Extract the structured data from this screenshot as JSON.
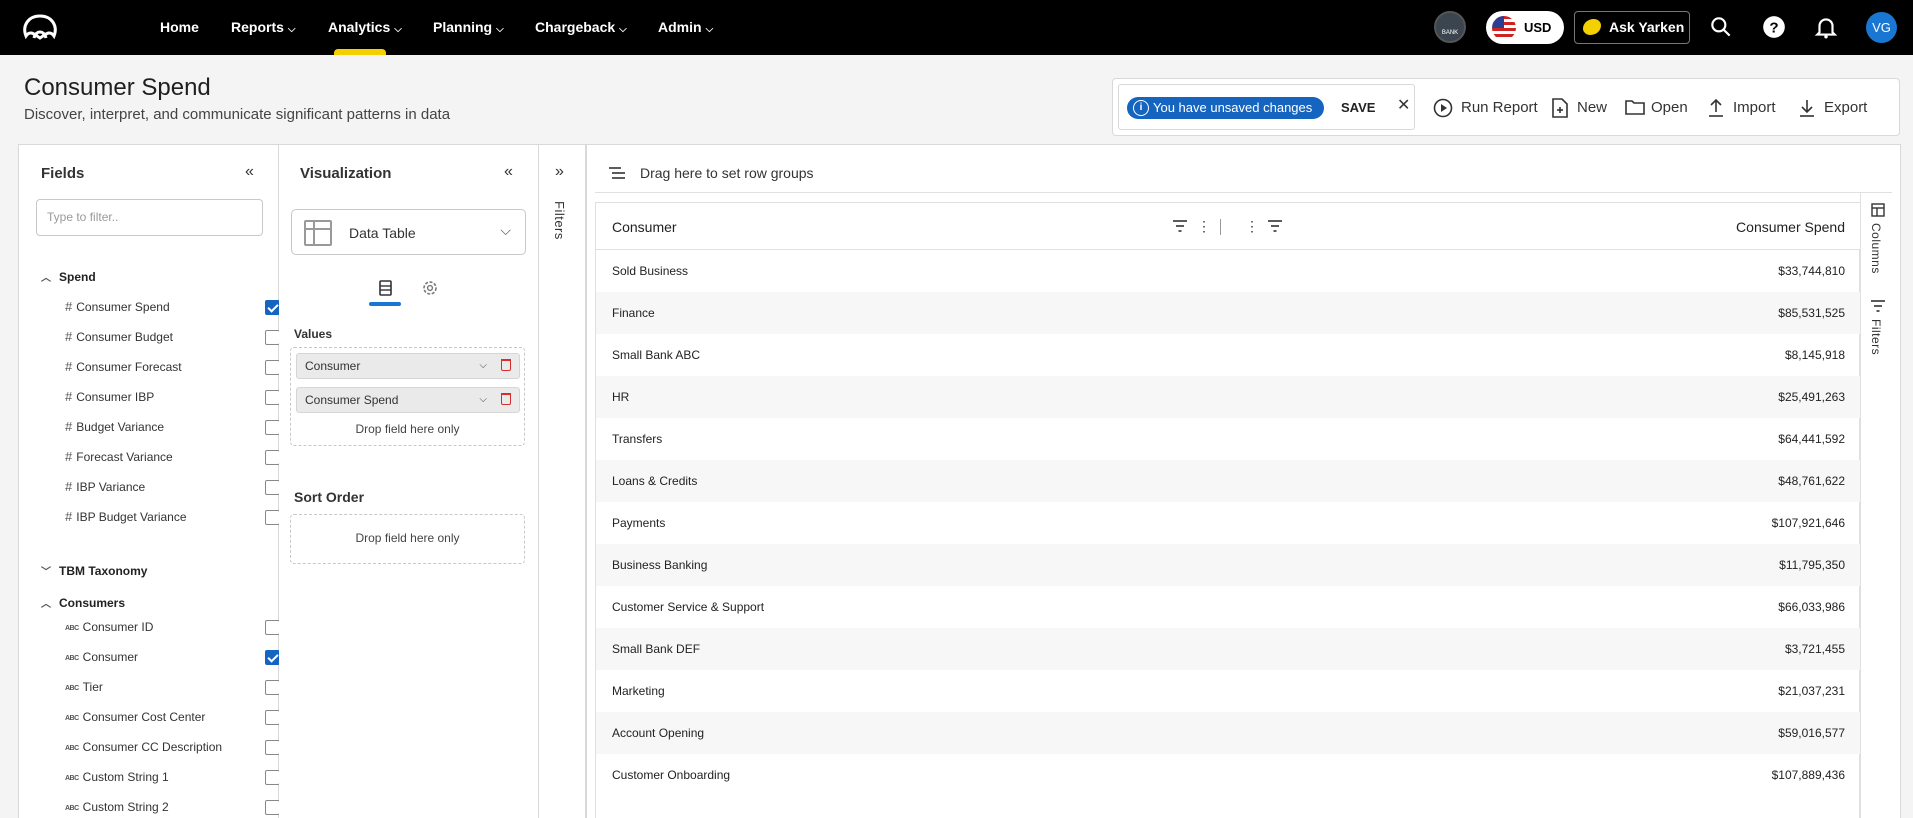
{
  "nav": {
    "items": [
      {
        "label": "Home",
        "dropdown": false,
        "active": false
      },
      {
        "label": "Reports",
        "dropdown": true,
        "active": false
      },
      {
        "label": "Analytics",
        "dropdown": true,
        "active": true
      },
      {
        "label": "Planning",
        "dropdown": true,
        "active": false
      },
      {
        "label": "Chargeback",
        "dropdown": true,
        "active": false
      },
      {
        "label": "Admin",
        "dropdown": true,
        "active": false
      }
    ],
    "bank_icon_label": "BANK",
    "currency": "USD",
    "ask_label": "Ask Yarken",
    "avatar_initials": "VG",
    "accent_color": "#f5d000"
  },
  "header": {
    "title": "Consumer Spend",
    "subtitle": "Discover, interpret, and communicate significant patterns in data"
  },
  "toolbar": {
    "unsaved_label": "You have unsaved changes",
    "save_label": "SAVE",
    "run_label": "Run Report",
    "new_label": "New",
    "open_label": "Open",
    "import_label": "Import",
    "export_label": "Export"
  },
  "fields": {
    "title": "Fields",
    "filter_placeholder": "Type to filter..",
    "groups": {
      "spend": {
        "label": "Spend",
        "items": [
          {
            "label": "Consumer Spend",
            "checked": true
          },
          {
            "label": "Consumer Budget",
            "checked": false
          },
          {
            "label": "Consumer Forecast",
            "checked": false
          },
          {
            "label": "Consumer IBP",
            "checked": false
          },
          {
            "label": "Budget Variance",
            "checked": false
          },
          {
            "label": "Forecast Variance",
            "checked": false
          },
          {
            "label": "IBP Variance",
            "checked": false
          },
          {
            "label": "IBP Budget Variance",
            "checked": false
          }
        ]
      },
      "tbm": {
        "label": "TBM Taxonomy"
      },
      "consumers": {
        "label": "Consumers",
        "items": [
          {
            "label": "Consumer ID",
            "checked": false
          },
          {
            "label": "Consumer",
            "checked": true
          },
          {
            "label": "Tier",
            "checked": false
          },
          {
            "label": "Consumer Cost Center",
            "checked": false
          },
          {
            "label": "Consumer CC Description",
            "checked": false
          },
          {
            "label": "Custom String 1",
            "checked": false
          },
          {
            "label": "Custom String 2",
            "checked": false
          }
        ]
      }
    }
  },
  "visualization": {
    "title": "Visualization",
    "selected_type": "Data Table",
    "values_label": "Values",
    "values": [
      "Consumer",
      "Consumer Spend"
    ],
    "drop_hint": "Drop field here only",
    "sort_label": "Sort Order"
  },
  "filters_label": "Filters",
  "grid": {
    "rowgroup_hint": "Drag here to set row groups",
    "columns": [
      "Consumer",
      "Consumer Spend"
    ],
    "rows": [
      [
        "Sold Business",
        "$33,744,810"
      ],
      [
        "Finance",
        "$85,531,525"
      ],
      [
        "Small Bank ABC",
        "$8,145,918"
      ],
      [
        "HR",
        "$25,491,263"
      ],
      [
        "Transfers",
        "$64,441,592"
      ],
      [
        "Loans & Credits",
        "$48,761,622"
      ],
      [
        "Payments",
        "$107,921,646"
      ],
      [
        "Business Banking",
        "$11,795,350"
      ],
      [
        "Customer Service & Support",
        "$66,033,986"
      ],
      [
        "Small Bank DEF",
        "$3,721,455"
      ],
      [
        "Marketing",
        "$21,037,231"
      ],
      [
        "Account Opening",
        "$59,016,577"
      ],
      [
        "Customer Onboarding",
        "$107,889,436"
      ]
    ],
    "side_columns_label": "Columns",
    "side_filters_label": "Filters"
  }
}
